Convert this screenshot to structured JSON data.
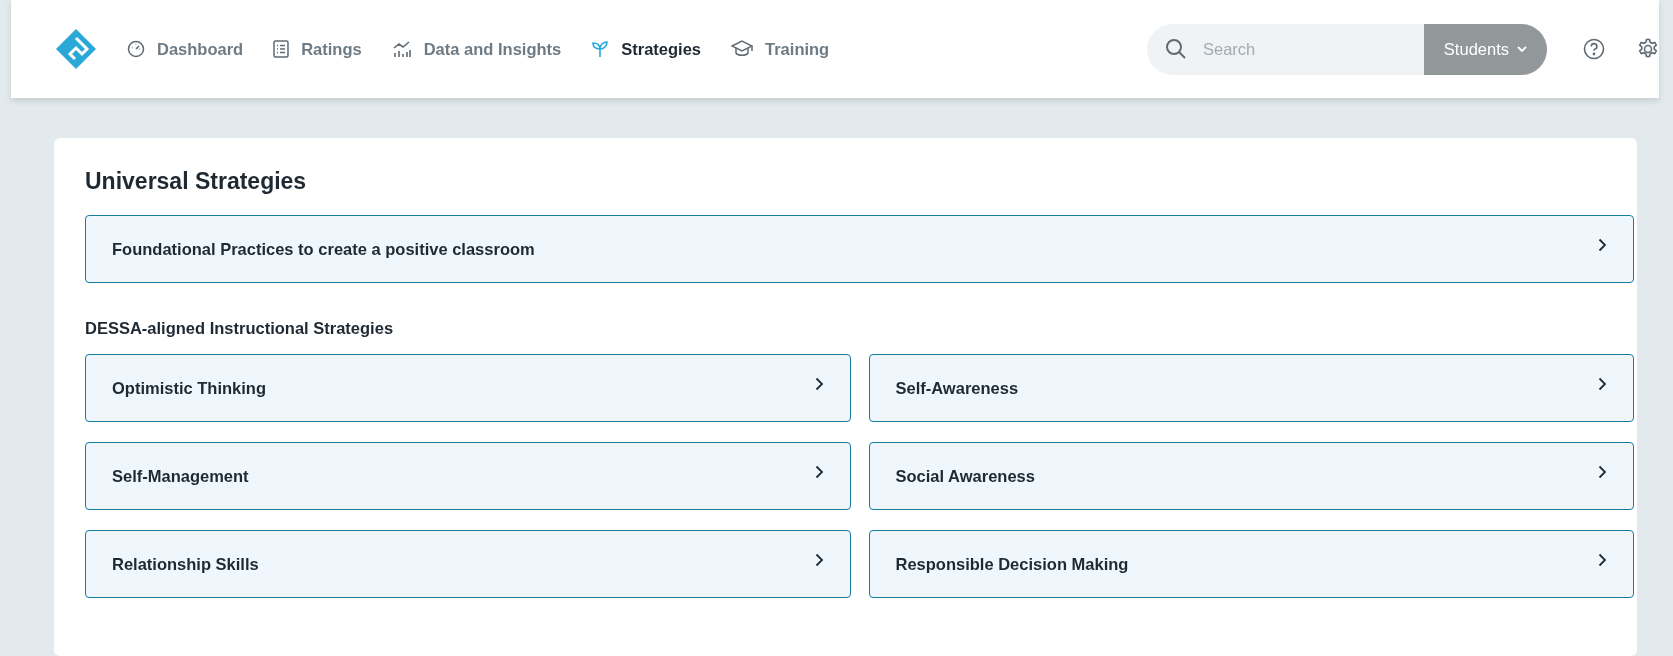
{
  "nav": [
    {
      "label": "Dashboard",
      "selected": false
    },
    {
      "label": "Ratings",
      "selected": false
    },
    {
      "label": "Data and Insights",
      "selected": false
    },
    {
      "label": "Strategies",
      "selected": true
    },
    {
      "label": "Training",
      "selected": false
    }
  ],
  "search": {
    "placeholder": "Search",
    "scope": "Students"
  },
  "universal": {
    "title": "Universal Strategies",
    "items": [
      "Foundational Practices to create a positive classroom"
    ]
  },
  "instructional": {
    "title": "DESSA-aligned Instructional Strategies",
    "items": [
      "Optimistic Thinking",
      "Self-Awareness",
      "Self-Management",
      "Social Awareness",
      "Relationship Skills",
      "Responsible Decision Making"
    ]
  }
}
